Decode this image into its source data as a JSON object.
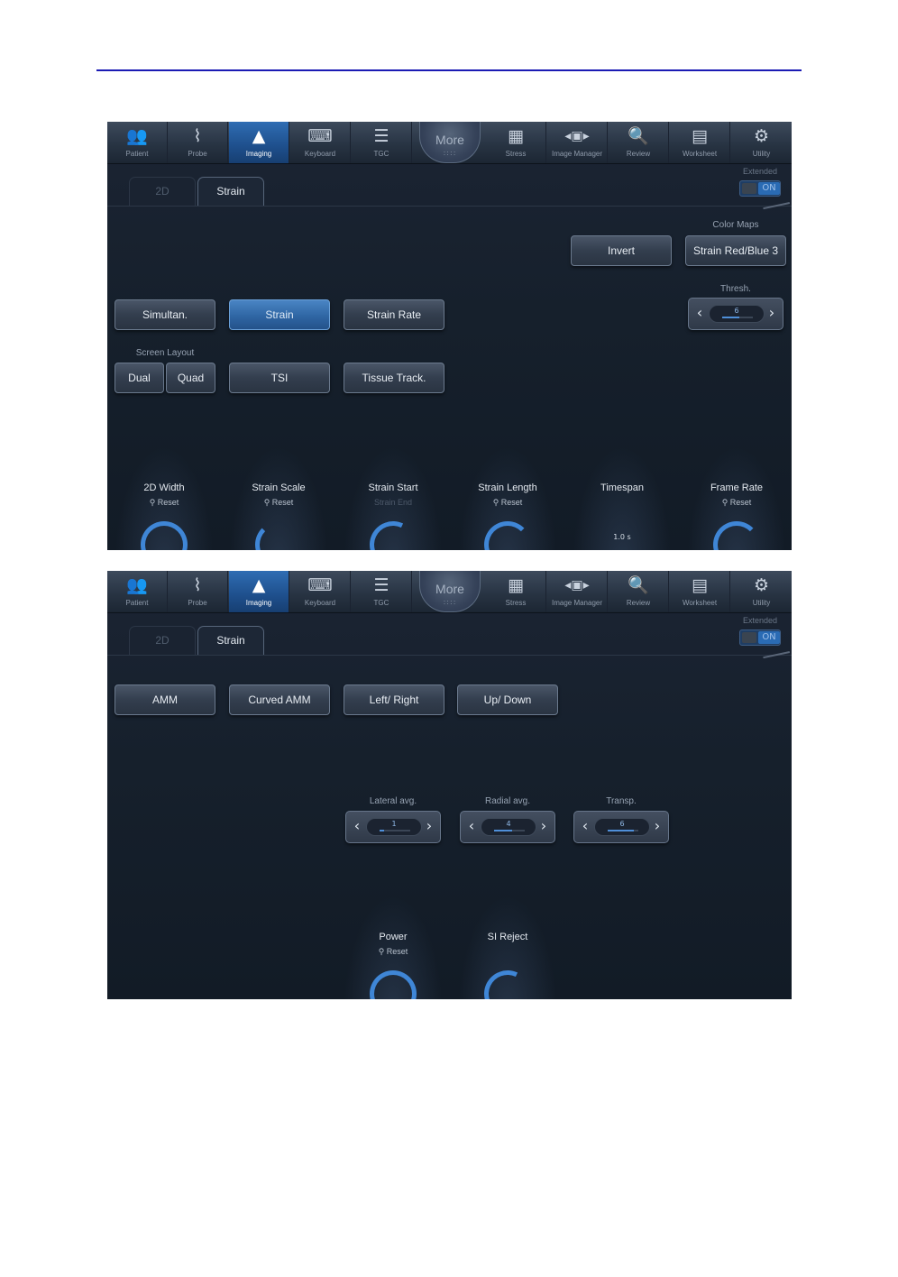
{
  "colors": {
    "accent": "#2f6db3",
    "rule": "#1b1bb4",
    "panel": "#16202c"
  },
  "panels": [
    {
      "toolbar": [
        {
          "label": "Patient",
          "icon": "patient-icon",
          "glyph": "👥"
        },
        {
          "label": "Probe",
          "icon": "probe-icon",
          "glyph": "⌇"
        },
        {
          "label": "Imaging",
          "icon": "imaging-icon",
          "glyph": "▲",
          "active": true
        },
        {
          "label": "Keyboard",
          "icon": "keyboard-icon",
          "glyph": "⌨"
        },
        {
          "label": "TGC",
          "icon": "tgc-icon",
          "glyph": "☰"
        },
        {
          "label": "Stress",
          "icon": "stress-icon",
          "glyph": "▦"
        },
        {
          "label": "Image Manager",
          "icon": "image-manager-icon",
          "glyph": "◂▣▸"
        },
        {
          "label": "Review",
          "icon": "review-icon",
          "glyph": "🔍"
        },
        {
          "label": "Worksheet",
          "icon": "worksheet-icon",
          "glyph": "▤"
        },
        {
          "label": "Utility",
          "icon": "utility-icon",
          "glyph": "⚙"
        }
      ],
      "more": {
        "label": "More",
        "dots": "::::"
      },
      "tabs": [
        "2D",
        "Strain"
      ],
      "extended": {
        "label": "Extended",
        "toggle": "ON"
      },
      "color_maps_label": "Color Maps",
      "thresh_label": "Thresh.",
      "thresh_value": "6",
      "screen_layout_label": "Screen Layout",
      "buttons": {
        "invert": "Invert",
        "strain_red_blue": "Strain Red/Blue 3",
        "simultan": "Simultan.",
        "strain": "Strain",
        "strain_rate": "Strain Rate",
        "dual": "Dual",
        "quad": "Quad",
        "tsi": "TSI",
        "tissue_track": "Tissue Track."
      },
      "knobs": [
        {
          "label": "2D Width",
          "sub": "Reset"
        },
        {
          "label": "Strain Scale",
          "sub": "Reset"
        },
        {
          "label": "Strain Start",
          "sub": "Strain End"
        },
        {
          "label": "Strain Length",
          "sub": "Reset"
        },
        {
          "label": "Timespan",
          "sub": "",
          "value": "1.0 s"
        },
        {
          "label": "Frame Rate",
          "sub": "Reset"
        }
      ]
    },
    {
      "tabs": [
        "2D",
        "Strain"
      ],
      "extended": {
        "label": "Extended",
        "toggle": "ON"
      },
      "buttons": {
        "amm": "AMM",
        "curved_amm": "Curved AMM",
        "left_right": "Left/ Right",
        "up_down": "Up/ Down"
      },
      "steppers": [
        {
          "label": "Lateral avg.",
          "value": "1",
          "level": 0.15
        },
        {
          "label": "Radial avg.",
          "value": "4",
          "level": 0.6
        },
        {
          "label": "Transp.",
          "value": "6",
          "level": 0.85
        }
      ],
      "knobs": [
        {
          "label": "Power",
          "sub": "Reset"
        },
        {
          "label": "SI Reject",
          "sub": ""
        }
      ]
    }
  ],
  "thresh_level": 0.55
}
